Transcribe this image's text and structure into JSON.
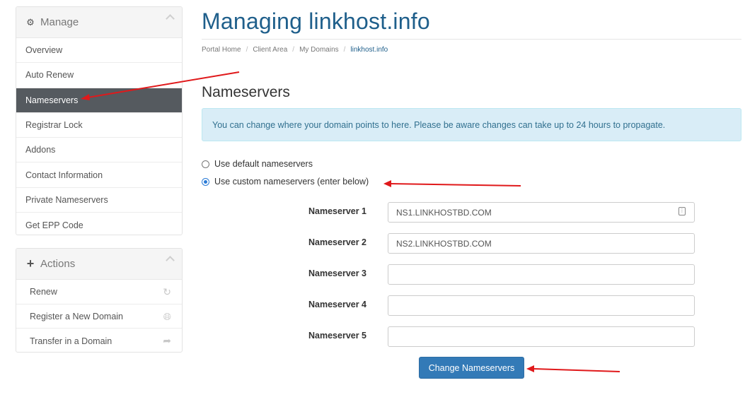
{
  "sidebar": {
    "manage": {
      "title": "Manage",
      "items": [
        {
          "label": "Overview"
        },
        {
          "label": "Auto Renew"
        },
        {
          "label": "Nameservers"
        },
        {
          "label": "Registrar Lock"
        },
        {
          "label": "Addons"
        },
        {
          "label": "Contact Information"
        },
        {
          "label": "Private Nameservers"
        },
        {
          "label": "Get EPP Code"
        }
      ]
    },
    "actions": {
      "title": "Actions",
      "items": [
        {
          "label": "Renew",
          "icon": "refresh-icon"
        },
        {
          "label": "Register a New Domain",
          "icon": "globe-icon"
        },
        {
          "label": "Transfer in a Domain",
          "icon": "share-arrow-icon"
        }
      ]
    }
  },
  "main": {
    "title": "Managing linkhost.info",
    "breadcrumb": [
      "Portal Home",
      "Client Area",
      "My Domains",
      "linkhost.info"
    ],
    "section_title": "Nameservers",
    "info": "You can change where your domain points to here. Please be aware changes can take up to 24 hours to propagate.",
    "options": {
      "default_label": "Use default nameservers",
      "custom_label": "Use custom nameservers (enter below)",
      "selected": "custom"
    },
    "nameservers": [
      {
        "label": "Nameserver 1",
        "value": "NS1.LINKHOSTBD.COM"
      },
      {
        "label": "Nameserver 2",
        "value": "NS2.LINKHOSTBD.COM"
      },
      {
        "label": "Nameserver 3",
        "value": ""
      },
      {
        "label": "Nameserver 4",
        "value": ""
      },
      {
        "label": "Nameserver 5",
        "value": ""
      }
    ],
    "submit_label": "Change Nameservers"
  },
  "colors": {
    "accent": "#1f5f8b",
    "active_menu_bg": "#555a5f",
    "button": "#337ab7",
    "info_bg": "#d9edf7",
    "annotation_arrow": "#e0191b"
  }
}
